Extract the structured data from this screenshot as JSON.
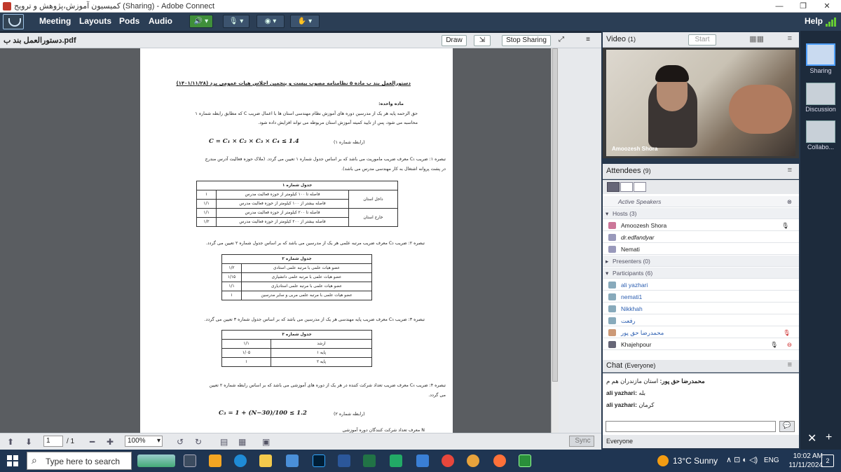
{
  "window": {
    "title": "کمیسیون آموزش،پژوهش و ترویج (Sharing) - Adobe Connect",
    "minimize": "—",
    "maximize": "❐",
    "close": "✕"
  },
  "menu": {
    "items": [
      "Meeting",
      "Layouts",
      "Pods",
      "Audio"
    ],
    "help": "Help"
  },
  "share_pod": {
    "file_name": "دستورالعمل بند ب.pdf",
    "draw_label": "Draw",
    "stop_sharing_label": "Stop Sharing",
    "menu_glyph": "≡"
  },
  "document": {
    "title": "دستورالعمل بند ب ماده ۵ نظامنامه مصوب بیست و پنجمین اجلاس هیات عمومی یزد (۱۴۰۱/۱۱/۲۸)",
    "section": "ماده واحده:",
    "para1": "حق الزحمه پایه هر یک از مدرسین دوره های آموزش نظام مهندسی استان ها با اعمال ضریب C که مطابق رابطه شماره ۱",
    "para1b": "محاسبه می شود، پس از تایید کمیته آموزش استان مربوطه می تواند افزایش داده شود.",
    "formula1": "C = C₁ × C₂ × C₃ × C₄ ≤ 1.4",
    "formula1_label": "(رابطه شماره ۱)",
    "note1": "تبصره ۱: ضریب C₁ معرف ضریب ماموریت می باشد که بر اساس جدول شماره ۱ تعیین می گردد. (ملاک حوزه فعالیت آدرس مندرج",
    "note1b": "در پشت پروانه اشتغال به کار مهندسی مدرس می باشد).",
    "table1": {
      "caption": "جدول شماره ۱",
      "rows": [
        {
          "v": "۱",
          "desc": "فاصله تا ۱۰۰ کیلومتر از حوزه فعالیت مدرس",
          "grp": "داخل استان"
        },
        {
          "v": "۱/۱",
          "desc": "فاصله بیشتر از ۱۰۰ کیلومتر از حوزه فعالیت مدرس",
          "grp": ""
        },
        {
          "v": "۱/۱",
          "desc": "فاصله تا ۲۰۰ کیلومتر از حوزه فعالیت مدرس",
          "grp": "خارج استان"
        },
        {
          "v": "۱/۲",
          "desc": "فاصله بیشتر از ۲۰۰ کیلومتر از حوزه فعالیت مدرس",
          "grp": ""
        }
      ]
    },
    "note2": "تبصره ۲: ضریب C₂ معرف ضریب مرتبه علمی هر یک از مدرسین می باشد که بر اساس جدول شماره ۲ تعیین می گردد.",
    "table2": {
      "caption": "جدول شماره ۲",
      "rows": [
        {
          "v": "۱/۲",
          "desc": "عضو هیات علمی با مرتبه علمی استادی"
        },
        {
          "v": "۱/۱۵",
          "desc": "عضو هیات علمی با مرتبه علمی دانشیاری"
        },
        {
          "v": "۱/۱",
          "desc": "عضو هیات علمی با مرتبه علمی استادیاری"
        },
        {
          "v": "۱",
          "desc": "عضو هیات علمی با مرتبه علمی مربی و سایر مدرسین"
        }
      ]
    },
    "note3": "تبصره ۳: ضریب C₃ معرف ضریب پایه مهندسی هر یک از مدرسین می باشد که بر اساس جدول شماره ۳ تعیین می گردد.",
    "table3": {
      "caption": "جدول شماره ۳",
      "rows": [
        {
          "v": "۱/۱",
          "desc": "ارشد"
        },
        {
          "v": "۱/۰۵",
          "desc": "پایه ۱"
        },
        {
          "v": "۱",
          "desc": "پایه ۲"
        }
      ]
    },
    "note4": "تبصره ۴: ضریب C₄ معرف ضریب تعداد شرکت کننده در هر یک از دوره های آموزشی می باشد که بر اساس رابطه شماره ۲ تعیین",
    "note4b": "می گردد.",
    "formula2": "C₃ = 1 + (N−30)/100 ≤ 1.2",
    "formula2_label": "(رابطه شماره ۲)",
    "cut_line": "N معرف تعداد شرکت کنندگان دوره آموزشی"
  },
  "doc_toolbar": {
    "page_value": "1",
    "page_total": "/ 1",
    "zoom": "100%",
    "sync_label": "Sync"
  },
  "video_pod": {
    "title": "Video",
    "count": "(1)",
    "start_label": "Start",
    "presenter_name": "Amoozesh Shora"
  },
  "attendees_pod": {
    "title": "Attendees",
    "count": "(9)",
    "active_speakers": "Active Speakers",
    "hosts_header": "Hosts (3)",
    "hosts": [
      "Amoozesh Shora",
      "dr.edfandyar",
      "Nemati"
    ],
    "presenters_header": "Presenters (0)",
    "participants_header": "Participants (6)",
    "participants": [
      "ali yazhari",
      "nemati1",
      "Nikkhah",
      "رفعت",
      "محمدرضا حق پور",
      "Khajehpour"
    ]
  },
  "chat_pod": {
    "title": "Chat",
    "scope": "(Everyone)",
    "messages": [
      {
        "sender": "محمدرضا حق پور:",
        "text": "استان مازندران هم م"
      },
      {
        "sender": "ali yazhari:",
        "text": "بله"
      },
      {
        "sender": "ali yazhari:",
        "text": "کرمان"
      }
    ],
    "recipient": "Everyone"
  },
  "layouts": [
    "Sharing",
    "Discussion",
    "Collabo..."
  ],
  "taskbar": {
    "search_placeholder": "Type here to search",
    "weather": "13°C Sunny",
    "lang": "ENG",
    "time": "10:02 AM",
    "date": "11/11/2024",
    "notif_count": "2"
  },
  "colors": {
    "accent": "#4fa0ff",
    "menubar": "#2b3e55",
    "taskbar": "#1f3552"
  }
}
